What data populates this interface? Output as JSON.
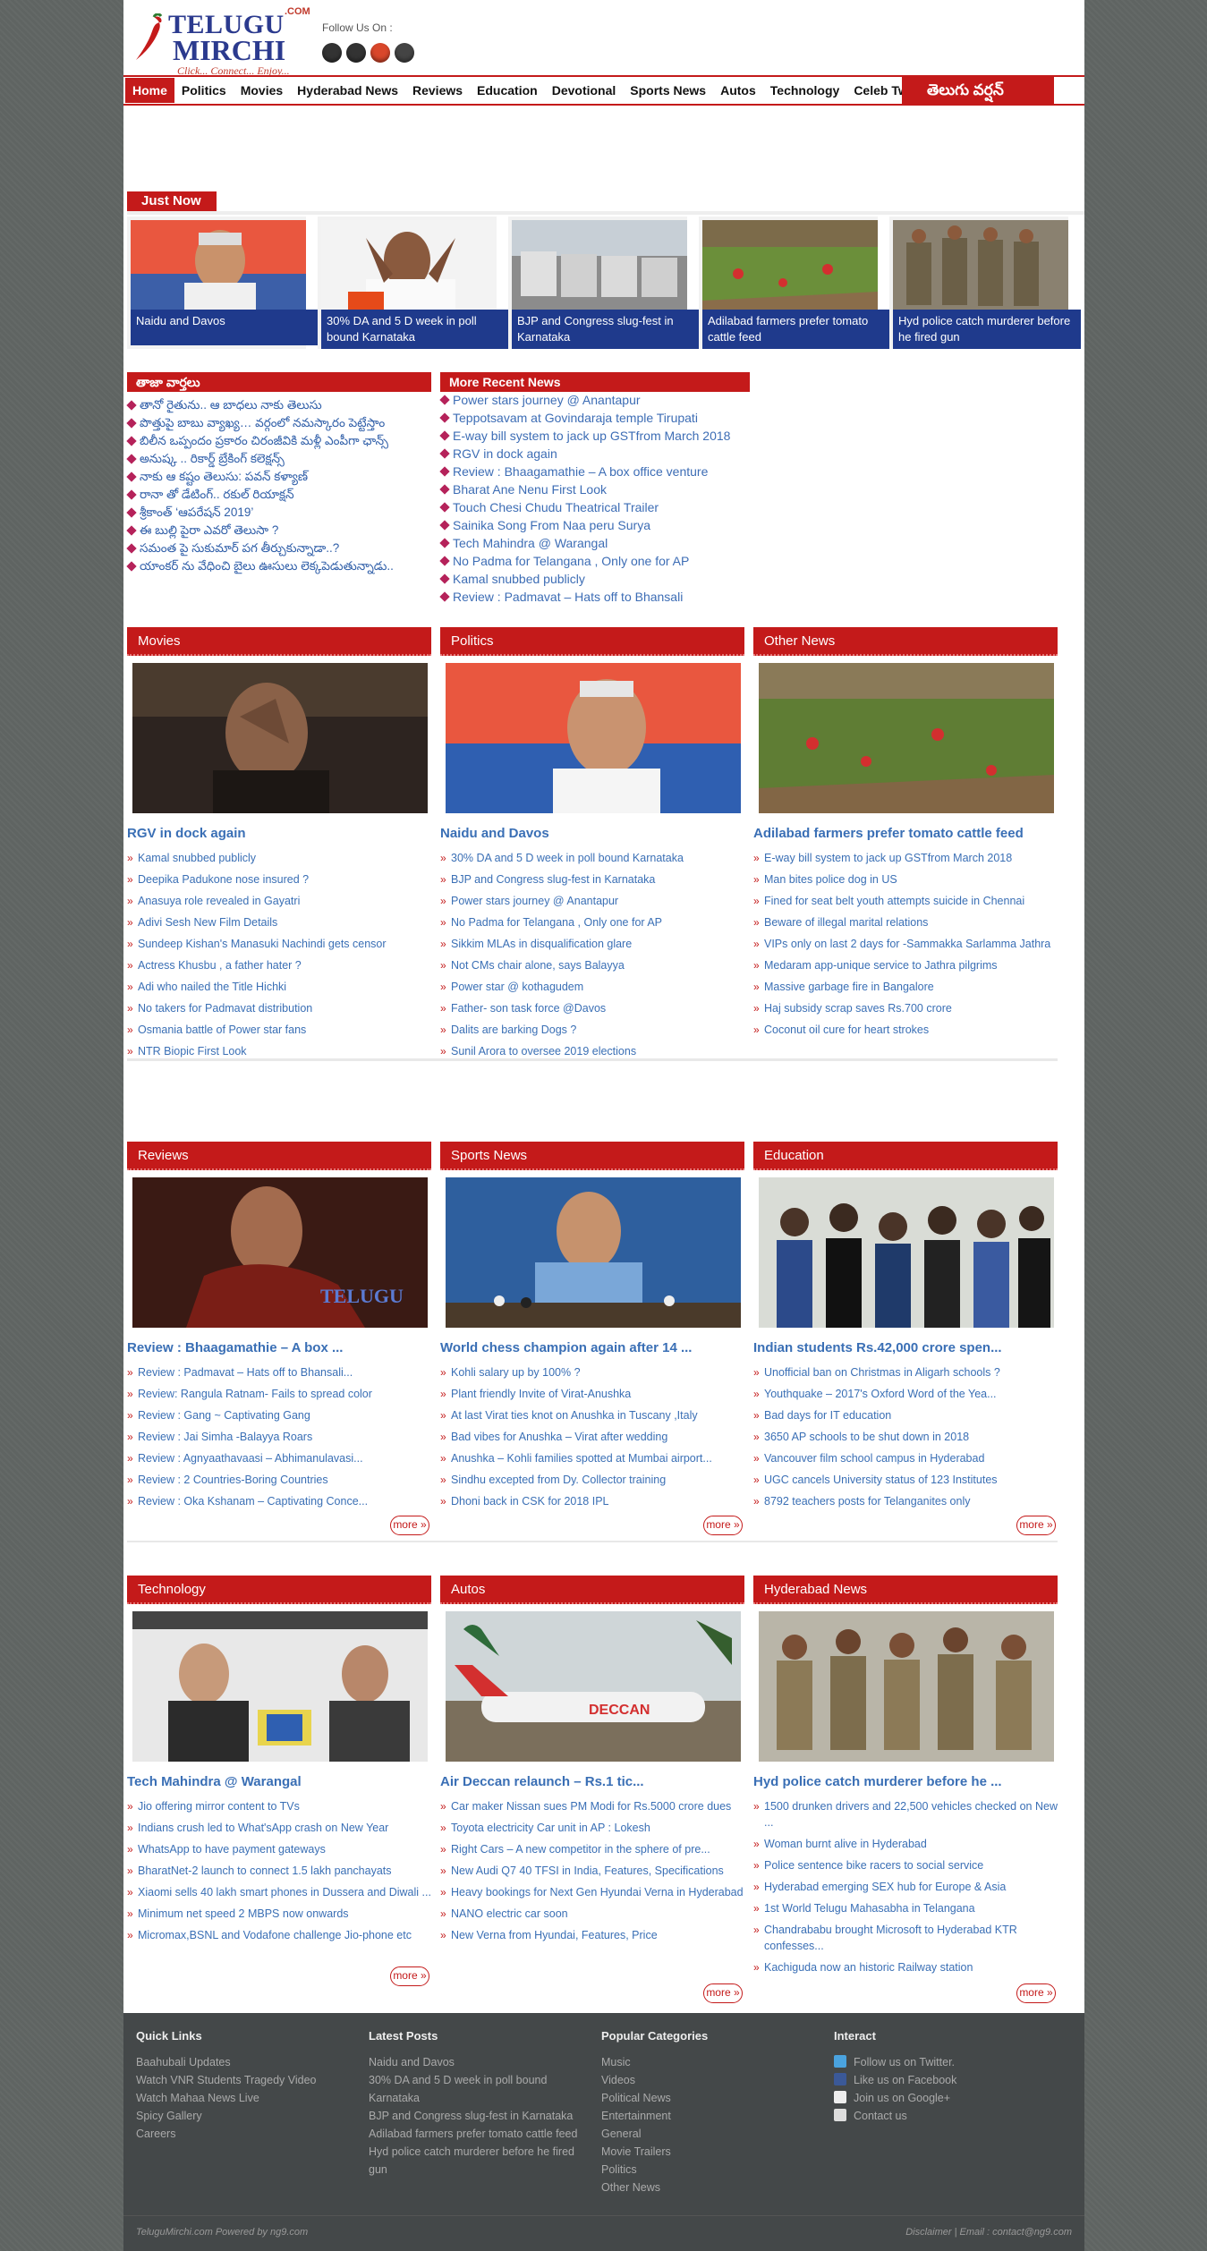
{
  "header": {
    "logo_line1": "TELUGU",
    "logo_line2": "MIRCHI",
    "logo_com": ".COM",
    "logo_tagline": "Click... Connect... Enjoy...",
    "follow_label": "Follow Us On :",
    "social_icons": [
      "github-icon",
      "twitter-icon",
      "google-plus-icon",
      "youtube-icon"
    ]
  },
  "nav": {
    "items": [
      "Home",
      "Politics",
      "Movies",
      "Hyderabad News",
      "Reviews",
      "Education",
      "Devotional",
      "Sports News",
      "Autos",
      "Technology",
      "Celeb Tweets"
    ],
    "telugu_version": "తెలుగు వర్షన్"
  },
  "just_now": {
    "label": "Just Now",
    "cards": [
      {
        "caption": "Naidu and Davos"
      },
      {
        "caption": "30% DA and 5 D week in poll bound Karnataka"
      },
      {
        "caption": "BJP and Congress slug-fest in Karnataka"
      },
      {
        "caption": "Adilabad farmers prefer tomato cattle feed"
      },
      {
        "caption": "Hyd police catch murderer before he fired gun"
      }
    ]
  },
  "taja": {
    "title": "తాజా వార్తలు",
    "items": [
      "తానో రైతును.. ఆ బాధలు నాకు తెలుసు",
      "పొత్తుపై బాబు వ్యాఖ్య… వర్గంలో నమస్కారం పెట్టేస్తాం",
      "బిలీన ఒప్పందం ప్రకారం చిరంజీవికి మళ్లీ ఎంపీగా ఛాన్స్",
      "అనుష్క .. రికార్డ్ బ్రేకింగ్ కలెక్షన్స్",
      "నాకు ఆ కష్టం తెలుసు: పవన్ కళ్యాణ్",
      "రానా తో డేటింగ్.. రకుల్ రియాక్షన్",
      "శ్రీకాంత్ ‘ఆపరేషన్ 2019’",
      "ఈ బుల్లి పైరా ఎవరో తెలుసా ?",
      "సమంత పై సుకుమార్ పగ తీర్చుకున్నాడా..?",
      "యాంకర్ ను వేధించి బైలు ఊసులు లెక్కపెడుతున్నాడు.."
    ]
  },
  "more_recent": {
    "title": "More Recent News",
    "items": [
      "Power stars journey @ Anantapur",
      "Teppotsavam at Govindaraja temple Tirupati",
      "E-way bill system to jack up GSTfrom March 2018",
      "RGV in dock again",
      "Review : Bhaagamathie – A box office venture",
      "Bharat Ane Nenu First Look",
      "Touch Chesi Chudu Theatrical Trailer",
      "Sainika Song From Naa peru Surya",
      "Tech Mahindra @ Warangal",
      "No Padma for Telangana , Only one for AP",
      "Kamal snubbed publicly",
      "Review : Padmavat – Hats off to Bhansali"
    ]
  },
  "sections_row1": [
    {
      "title": "Movies",
      "headline": "RGV in dock again",
      "items": [
        "Kamal snubbed publicly",
        "Deepika Padukone nose insured ?",
        "Anasuya role revealed in Gayatri",
        "Adivi Sesh New Film Details",
        "Sundeep Kishan's Manasuki Nachindi gets censor",
        "Actress Khusbu , a father hater ?",
        "Adi who nailed the Title Hichki",
        "No takers for Padmavat distribution",
        "Osmania battle of Power star fans",
        "NTR Biopic First Look"
      ]
    },
    {
      "title": "Politics",
      "headline": "Naidu and Davos",
      "items": [
        "30% DA and 5 D week in poll bound Karnataka",
        "BJP and Congress slug-fest in Karnataka",
        "Power stars journey @ Anantapur",
        "No Padma for Telangana , Only one for AP",
        "Sikkim MLAs in disqualification glare",
        "Not CMs chair alone, says Balayya",
        "Power star @ kothagudem",
        "Father- son task force @Davos",
        "Dalits are barking Dogs ?",
        "Sunil Arora to oversee 2019 elections"
      ]
    },
    {
      "title": "Other News",
      "headline": "Adilabad farmers prefer tomato cattle feed",
      "items": [
        "E-way bill system to jack up GSTfrom March 2018",
        "Man bites police dog in US",
        "Fined for seat belt youth attempts suicide in Chennai",
        "Beware of illegal marital relations",
        "VIPs only on last 2 days for -Sammakka Sarlamma Jathra",
        "Medaram app-unique service to Jathra pilgrims",
        "Massive garbage fire in Bangalore",
        "Haj subsidy scrap saves Rs.700 crore",
        "Coconut oil cure for heart strokes"
      ]
    }
  ],
  "sections_row2": [
    {
      "title": "Reviews",
      "headline": "Review : Bhaagamathie – A box ...",
      "items": [
        "Review : Padmavat – Hats off to Bhansali...",
        "Review: Rangula Ratnam- Fails to spread color",
        "Review : Gang ~ Captivating Gang",
        "Review : Jai Simha -Balayya Roars",
        "Review : Agnyaathavaasi – Abhimanulavasi...",
        "Review : 2 Countries-Boring Countries",
        "Review : Oka Kshanam – Captivating Conce..."
      ],
      "more": "more »"
    },
    {
      "title": "Sports News",
      "headline": "World chess champion again after 14 ...",
      "items": [
        "Kohli salary up by 100% ?",
        "Plant friendly Invite of Virat-Anushka",
        "At last Virat ties knot on Anushka in Tuscany ,Italy",
        "Bad vibes for Anushka – Virat after wedding",
        "Anushka – Kohli families spotted at Mumbai airport...",
        "Sindhu excepted from Dy. Collector training",
        "Dhoni back in CSK for 2018 IPL"
      ],
      "more": "more »"
    },
    {
      "title": "Education",
      "headline": "Indian students Rs.42,000 crore spen...",
      "items": [
        "Unofficial ban on Christmas in Aligarh schools ?",
        "Youthquake – 2017's Oxford Word of the Yea...",
        "Bad days for IT education",
        "3650 AP schools to be shut down in 2018",
        "Vancouver film school campus in Hyderabad",
        "UGC cancels University status of 123 Institutes",
        "8792 teachers posts for Telanganites only"
      ],
      "more": "more »"
    }
  ],
  "sections_row3": [
    {
      "title": "Technology",
      "headline": "Tech Mahindra @ Warangal",
      "items": [
        "Jio offering mirror content to TVs",
        "Indians crush led to What'sApp crash on New Year",
        "WhatsApp to have payment gateways",
        "BharatNet-2 launch to connect 1.5 lakh panchayats",
        "Xiaomi sells 40 lakh smart phones in Dussera and Diwali ...",
        "Minimum net speed 2 MBPS now onwards",
        "Micromax,BSNL and Vodafone challenge Jio-phone etc"
      ],
      "more": "more »"
    },
    {
      "title": "Autos",
      "headline": "Air Deccan relaunch – Rs.1 tic...",
      "items": [
        "Car maker Nissan sues PM Modi for Rs.5000 crore dues",
        "Toyota electricity Car unit in AP : Lokesh",
        "Right Cars – A new competitor in the sphere of pre...",
        "New Audi Q7 40 TFSI in India, Features, Specifications",
        "Heavy bookings for Next Gen Hyundai Verna in Hyderabad",
        "NANO electric car soon",
        "New Verna from Hyundai, Features, Price"
      ],
      "more": "more »"
    },
    {
      "title": "Hyderabad News",
      "headline": "Hyd police catch murderer before he ...",
      "items": [
        "1500 drunken drivers and 22,500 vehicles checked on New ...",
        "Woman burnt alive in Hyderabad",
        "Police sentence bike racers to social service",
        "Hyderabad emerging SEX hub for Europe & Asia",
        "1st World Telugu Mahasabha in Telangana",
        "Chandrababu brought Microsoft to Hyderabad KTR confesses...",
        "Kachiguda now an historic Railway station"
      ],
      "more": "more »"
    }
  ],
  "footer": {
    "quick_links": {
      "title": "Quick Links",
      "items": [
        "Baahubali Updates",
        "Watch VNR Students Tragedy Video",
        "Watch Mahaa News Live",
        "Spicy Gallery",
        "Careers"
      ]
    },
    "latest_posts": {
      "title": "Latest Posts",
      "items": [
        "Naidu and Davos",
        "30% DA and 5 D week in poll bound Karnataka",
        "BJP and Congress slug-fest in Karnataka",
        "Adilabad farmers prefer tomato cattle feed",
        "Hyd police catch murderer before he fired gun"
      ]
    },
    "popular": {
      "title": "Popular Categories",
      "items": [
        "Music",
        "Videos",
        "Political News",
        "Entertainment",
        "General",
        "Movie Trailers",
        "Politics",
        "Other News"
      ]
    },
    "interact": {
      "title": "Interact",
      "items": [
        "Follow us on Twitter.",
        "Like us on Facebook",
        "Join us on Google+",
        "Contact us"
      ]
    },
    "bottom_left": "TeluguMirchi.com Powered by ng9.com",
    "bottom_right": "Disclaimer | Email : contact@ng9.com"
  },
  "colors": {
    "brand_red": "#c41a1a",
    "link_blue": "#3a6fb5",
    "caption_blue": "#1f3a8c"
  }
}
